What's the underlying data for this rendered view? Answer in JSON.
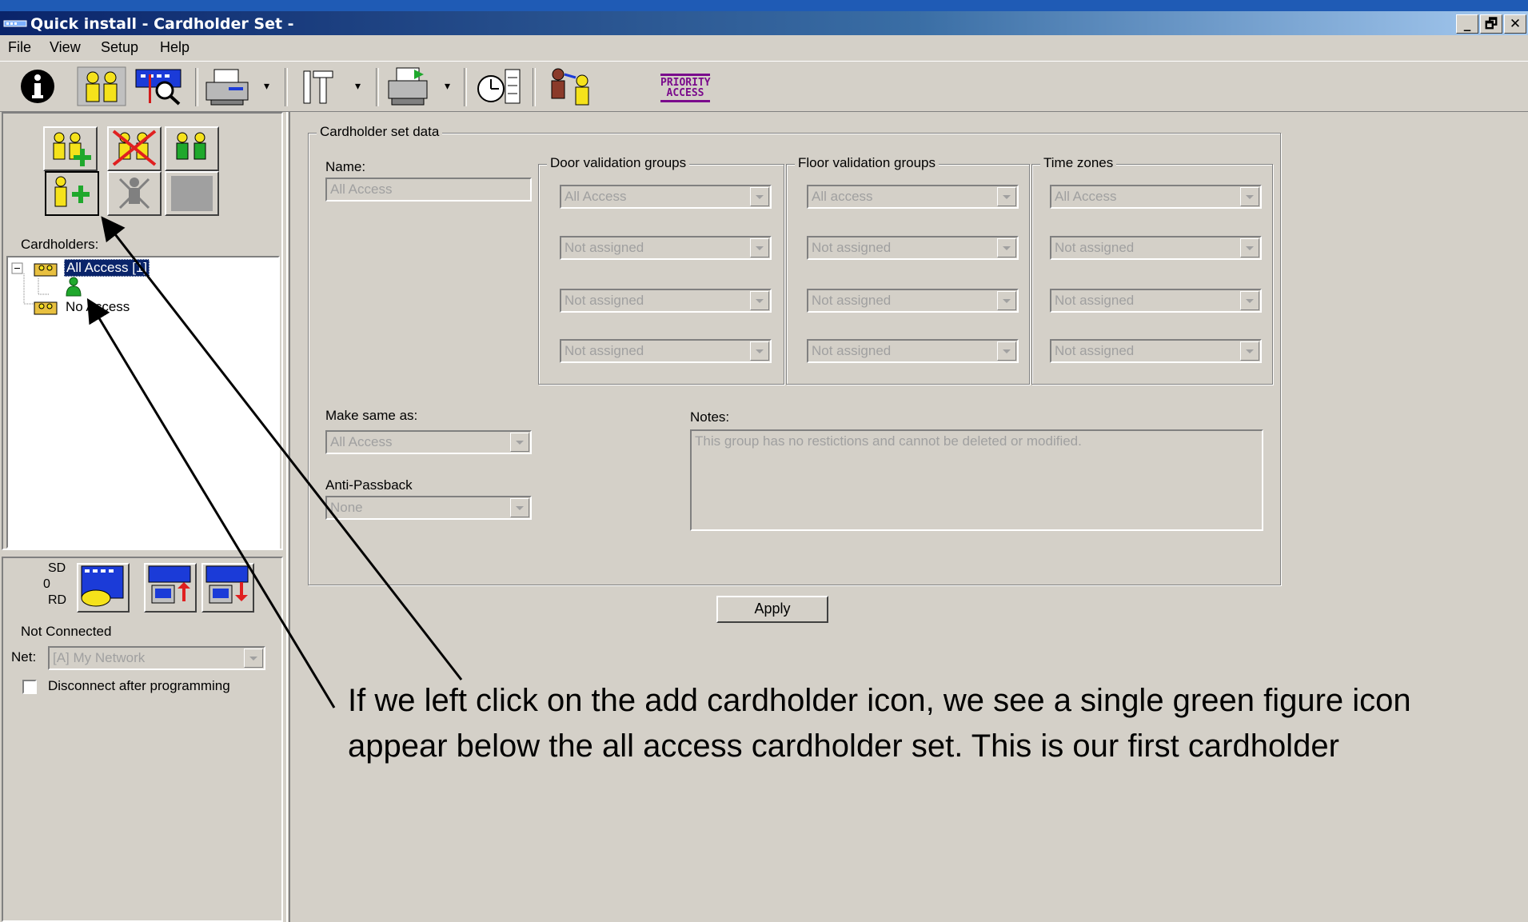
{
  "window": {
    "title": "Quick install - Cardholder Set -",
    "controls": [
      "_",
      "🗗",
      "✕"
    ]
  },
  "menu": [
    "File",
    "View",
    "Setup",
    "Help"
  ],
  "toolbar": {
    "icons": [
      "info-icon",
      "cardholders-icon",
      "search-network-icon",
      "printer-icon",
      "tools-icon",
      "reports-icon",
      "time-schedule-icon",
      "transfer-icon"
    ],
    "priority_label": "PRIORITY ACCESS"
  },
  "left": {
    "cardholders_label": "Cardholders:",
    "tree": {
      "group1": "All Access [1]",
      "group2": "No Access"
    },
    "sd_label": "SD",
    "counter": "0",
    "rd_label": "RD",
    "connection_status": "Not Connected",
    "net_label": "Net:",
    "net_value": "[A] My Network",
    "disconnect_label": "Disconnect after programming"
  },
  "form": {
    "group_title": "Cardholder set data",
    "name_label": "Name:",
    "name_value": "All Access",
    "door_title": "Door validation groups",
    "floor_title": "Floor validation groups",
    "time_title": "Time zones",
    "door": [
      "All Access",
      "Not assigned",
      "Not assigned",
      "Not assigned"
    ],
    "floor": [
      "All access",
      "Not assigned",
      "Not assigned",
      "Not assigned"
    ],
    "time": [
      "All Access",
      "Not assigned",
      "Not assigned",
      "Not assigned"
    ],
    "same_as_label": "Make same as:",
    "same_as_value": "All Access",
    "antipass_label": "Anti-Passback",
    "antipass_value": "None",
    "notes_label": "Notes:",
    "notes_value": "This group has no restictions and cannot be deleted or modified.",
    "apply_label": "Apply"
  },
  "caption": "If we left click on the add cardholder icon, we see a single green figure icon appear below the all access cardholder set. This is our first cardholder",
  "colors": {
    "titlebar": "#0a246a",
    "face": "#d4d0c8",
    "selection": "#0a246a",
    "figure_green": "#1fa82c",
    "figure_yellow": "#f5e21b"
  }
}
